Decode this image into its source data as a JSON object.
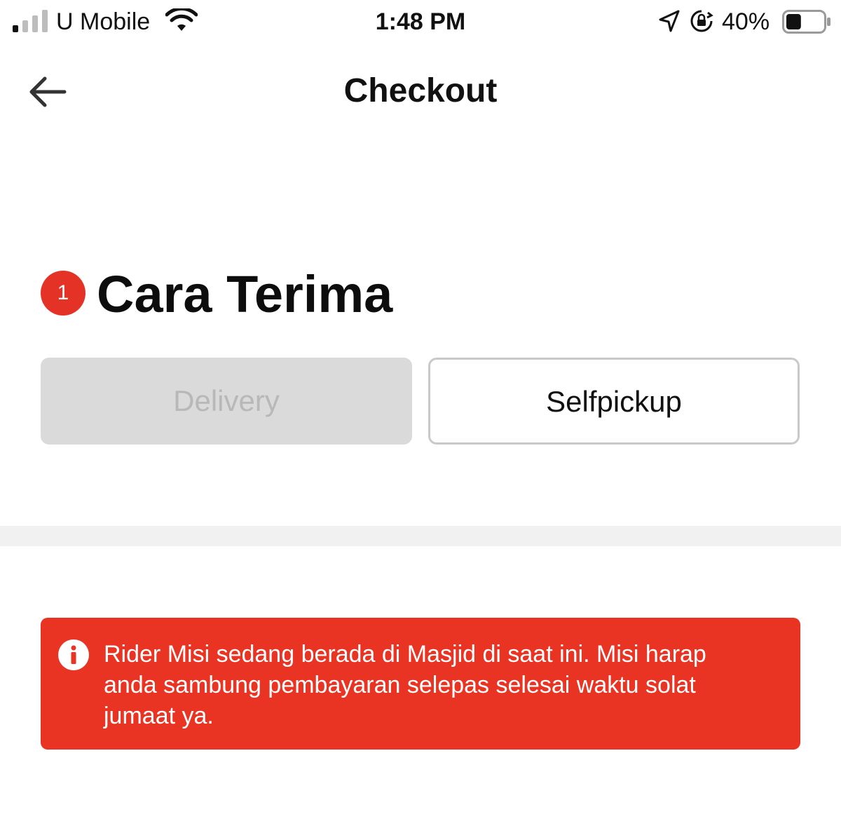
{
  "status_bar": {
    "carrier": "U Mobile",
    "time": "1:48 PM",
    "battery_percent": "40%",
    "signal_bars_active": 1,
    "signal_bars_total": 4,
    "battery_level": 0.4,
    "icons": [
      "signal-icon",
      "wifi-icon",
      "location-icon",
      "rotation-lock-icon",
      "battery-icon"
    ]
  },
  "header": {
    "back_icon": "arrow-left-icon",
    "title": "Checkout"
  },
  "section": {
    "step_number": "1",
    "title": "Cara Terima",
    "options": [
      {
        "label": "Delivery",
        "state": "disabled"
      },
      {
        "label": "Selfpickup",
        "state": "enabled"
      }
    ]
  },
  "alert": {
    "icon": "info-icon",
    "message": "Rider Misi sedang berada di Masjid di saat ini. Misi harap anda sambung pembayaran selepas selesai waktu solat jumaat ya."
  },
  "colors": {
    "accent_red": "#e93323",
    "badge_red": "#e53227",
    "disabled_bg": "#dadada",
    "disabled_text": "#b8b8b8",
    "divider": "#f1f1f1"
  }
}
